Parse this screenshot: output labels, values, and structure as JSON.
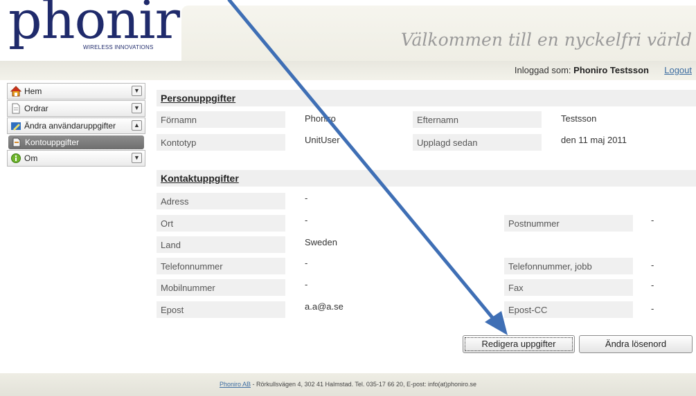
{
  "header": {
    "logo_text": "phoniro",
    "logo_sub": "WIRELESS INNOVATIONS",
    "welcome": "Välkommen till en nyckelfri värld",
    "login_prefix": "Inloggad som:",
    "user_name": "Phoniro Testsson",
    "logout": "Logout"
  },
  "sidebar": {
    "items": [
      {
        "label": "Hem",
        "icon": "home-icon"
      },
      {
        "label": "Ordrar",
        "icon": "document-icon"
      },
      {
        "label": "Ändra användaruppgifter",
        "icon": "edit-user-icon"
      },
      {
        "label": "Kontouppgifter",
        "icon": "page-icon"
      },
      {
        "label": "Om",
        "icon": "info-icon"
      }
    ]
  },
  "personal": {
    "title": "Personuppgifter",
    "fornamn_label": "Förnamn",
    "fornamn_value": "Phoniro",
    "efternamn_label": "Efternamn",
    "efternamn_value": "Testsson",
    "kontotyp_label": "Kontotyp",
    "kontotyp_value": "UnitUser",
    "upplagd_label": "Upplagd sedan",
    "upplagd_value": "den 11 maj 2011"
  },
  "contact": {
    "title": "Kontaktuppgifter",
    "adress_label": "Adress",
    "adress_value": "-",
    "ort_label": "Ort",
    "ort_value": "-",
    "postnummer_label": "Postnummer",
    "postnummer_value": "-",
    "land_label": "Land",
    "land_value": "Sweden",
    "telefon_label": "Telefonnummer",
    "telefon_value": "-",
    "telefon_jobb_label": "Telefonnummer, jobb",
    "telefon_jobb_value": "-",
    "mobil_label": "Mobilnummer",
    "mobil_value": "-",
    "fax_label": "Fax",
    "fax_value": "-",
    "epost_label": "Epost",
    "epost_value": "a.a@a.se",
    "epost_cc_label": "Epost-CC",
    "epost_cc_value": "-"
  },
  "buttons": {
    "edit": "Redigera uppgifter",
    "change_password": "Ändra lösenord"
  },
  "footer": {
    "company_link": "Phoniro AB",
    "text": " - Rörkullsvägen 4, 302 41 Halmstad. Tel. 035-17 66 20, E-post: info(at)phoniro.se"
  },
  "colors": {
    "brand": "#1f2a6b",
    "arrow": "#3f6fb5",
    "link": "#3a6ba0"
  }
}
